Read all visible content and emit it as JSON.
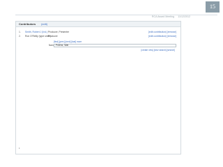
{
  "slide": {
    "number": "15",
    "footer_text": "RCA Award Meeting",
    "footer_date": "11/12/2012"
  },
  "panel": {
    "title": "Contributors",
    "title_link": "(edit)",
    "rows": [
      {
        "index": "1.",
        "name": "Smith, Robert J (Ind.)",
        "role": "Producer, Presenter",
        "actions": "[edit contribution] [remove]"
      },
      {
        "index": "2.",
        "name": "Ron O'Reilly (type smith)",
        "role": "Producer",
        "actions": "[edit contribution] [remove]"
      }
    ],
    "add_links": "[first] [prev] [next] [last] more",
    "name_label": "Name:",
    "name_value": "Polenz, Wat",
    "search_links": "[create new] [new search] [search]",
    "bottom_marker": "•"
  }
}
